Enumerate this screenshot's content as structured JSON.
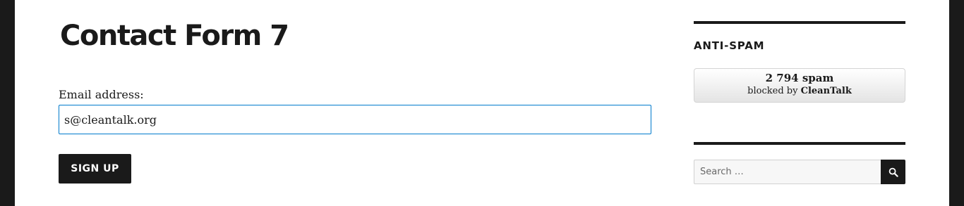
{
  "main": {
    "title": "Contact Form 7",
    "email_label": "Email address:",
    "email_value": "s@cleantalk.org",
    "submit_label": "SIGN UP"
  },
  "sidebar": {
    "antispam": {
      "title": "ANTI-SPAM",
      "count_text": "2 794 spam",
      "blocked_text": "blocked by",
      "brand": "CleanTalk"
    },
    "search": {
      "placeholder": "Search …",
      "value": "",
      "icon": "search-icon"
    }
  },
  "colors": {
    "outer_background": "#1a1a1a",
    "page_background": "#ffffff",
    "text": "#1a1a1a",
    "input_focus_border": "#007acc",
    "button_background": "#1a1a1a",
    "button_text": "#ffffff"
  }
}
